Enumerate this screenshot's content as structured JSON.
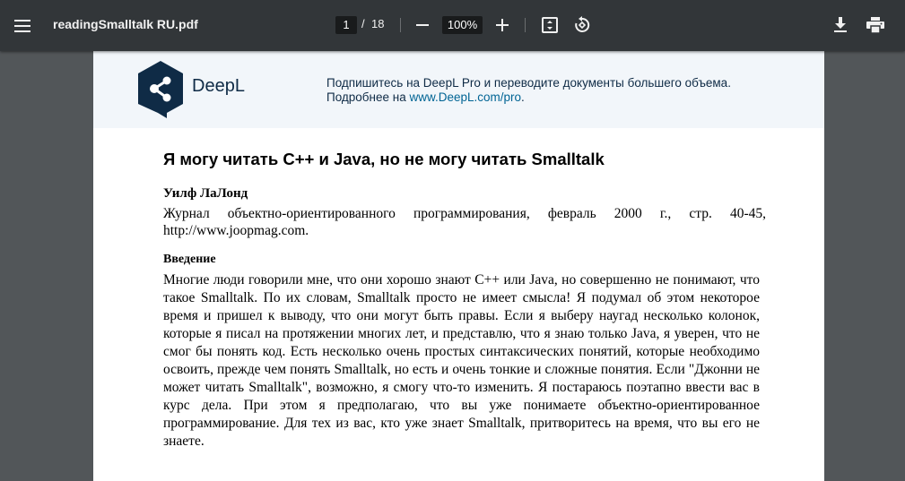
{
  "toolbar": {
    "filename": "readingSmalltalk RU.pdf",
    "current_page": "1",
    "page_separator": "/",
    "total_pages": "18",
    "zoom": "100%",
    "icons": [
      "menu-icon",
      "zoom-out-icon",
      "zoom-in-icon",
      "fit-page-icon",
      "rotate-icon",
      "download-icon",
      "print-icon"
    ]
  },
  "banner": {
    "brand": "DeepL",
    "promo_line1": "Подпишитесь на DeepL Pro и переводите документы большего объема.",
    "promo_line2_prefix": "Подробнее на ",
    "promo_link": "www.DeepL.com/pro",
    "promo_line2_suffix": ".",
    "brand_color": "#0f2b46"
  },
  "document": {
    "title": "Я могу читать C++ и Java, но не могу читать Smalltalk",
    "author": "Уилф ЛаЛонд",
    "citation": "Журнал объектно-ориентированного программирования, февраль 2000 г., стр. 40-45, http://www.joopmag.com.",
    "section_heading": "Введение",
    "paragraph": "Многие люди говорили мне, что они хорошо знают C++ или Java, но совершенно не понимают, что такое Smalltalk. По их словам, Smalltalk просто не имеет смысла! Я подумал об этом некоторое время и пришел к выводу, что они могут быть правы. Если я выберу наугад несколько колонок, которые я писал на протяжении многих лет, и представлю, что я знаю только Java, я уверен, что не смог бы понять код. Есть несколько очень простых синтаксических понятий, которые необходимо освоить, прежде чем понять Smalltalk, но есть и очень тонкие и сложные понятия. Если \"Джонни не может читать Smalltalk\", возможно, я смогу что-то изменить. Я постараюсь поэтапно ввести вас в курс дела. При этом я предполагаю, что вы уже понимаете объектно-ориентированное программирование. Для тех из вас, кто уже знает Smalltalk, притворитесь на время, что вы его не знаете."
  }
}
